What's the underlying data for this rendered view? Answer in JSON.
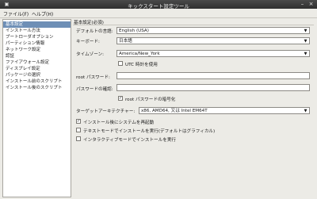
{
  "window": {
    "title": "キックスタート設定ツール"
  },
  "menu": {
    "file": "ファイル(F)",
    "help": "ヘルプ(H)"
  },
  "sidebar": {
    "items": [
      {
        "label": "基本設定",
        "selected": true
      },
      {
        "label": "インストール方法"
      },
      {
        "label": "ブートローダオプション"
      },
      {
        "label": "パーティション情報"
      },
      {
        "label": "ネットワーク設定"
      },
      {
        "label": "認証"
      },
      {
        "label": "ファイアウォール設定"
      },
      {
        "label": "ディスプレイ設定"
      },
      {
        "label": "パッケージの選択"
      },
      {
        "label": "インストール前のスクリプト"
      },
      {
        "label": "インストール後のスクリプト"
      }
    ]
  },
  "basic": {
    "section_title": "基本設定(必須)",
    "language_label": "デフォルトの言語:",
    "language_value": "English (USA)",
    "keyboard_label": "キーボード:",
    "keyboard_value": "日本語",
    "timezone_label": "タイムゾーン:",
    "timezone_value": "America/New_York",
    "utc_label": "UTC 時計を使用",
    "utc_checked": false,
    "root_pw_label": "root パスワード:",
    "root_pw_confirm_label": "パスワードの確認:",
    "encrypt_label": "root パスワードの暗号化",
    "encrypt_checked": true,
    "arch_label": "ターゲットアーキテクチャー:",
    "arch_value": "x86, AMD64, 又は Intel EM64T",
    "reboot_label": "インストール後にシステムを再起動",
    "reboot_checked": true,
    "text_mode_label": "テキストモードでインストールを実行(デフォルトはグラフィカル)",
    "text_mode_checked": false,
    "interactive_label": "インタラクティブモードでインストールを実行",
    "interactive_checked": false
  },
  "icons": {
    "dropdown": "▼",
    "check": "✓",
    "minimize": "–",
    "close": "×"
  }
}
